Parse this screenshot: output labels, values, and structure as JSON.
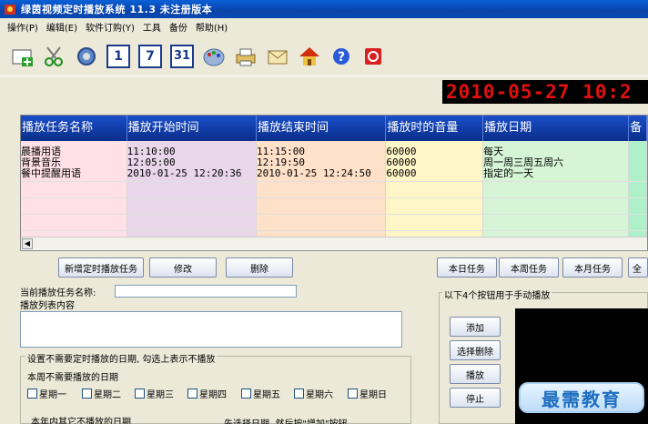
{
  "window": {
    "title": "绿茵视频定时播放系统 11.3  未注册版本"
  },
  "menu": [
    "操作(P)",
    "编辑(E)",
    "软件订购(Y)",
    "工具",
    "备份",
    "帮助(H)"
  ],
  "toolbar": {
    "icons": [
      "add-icon",
      "scissors-icon",
      "gear-icon",
      "calendar-1-icon",
      "calendar-7-icon",
      "calendar-31-icon",
      "palette-icon",
      "printer-icon",
      "mail-icon",
      "home-icon",
      "help-icon",
      "power-icon"
    ],
    "cal1": "1",
    "cal7": "7",
    "cal31": "31",
    "help": "?"
  },
  "clock": "2010-05-27 10:2",
  "grid": {
    "headers": [
      "播放任务名称",
      "播放开始时间",
      "播放结束时间",
      "播放时的音量",
      "播放日期",
      "备"
    ],
    "rows": [
      [
        "晨播用语",
        "11:10:00",
        "11:15:00",
        "60000",
        "每天"
      ],
      [
        "背景音乐",
        "12:05:00",
        "12:19:50",
        "60000",
        "周一周三周五周六"
      ],
      [
        "餐中提醒用语",
        "2010-01-25 12:20:36",
        "2010-01-25 12:24:50",
        "60000",
        "指定的一天"
      ]
    ]
  },
  "buttons": {
    "add_task": "新增定时播放任务",
    "modify": "修改",
    "delete": "删除",
    "today": "本日任务",
    "week": "本周任务",
    "month": "本月任务",
    "all": "全",
    "add": "添加",
    "select_delete": "选择删除",
    "play": "播放",
    "stop": "停止"
  },
  "form": {
    "current_task_label": "当前播放任务名称:",
    "current_task_value": "",
    "playlist_label": "播放列表内容",
    "skip_group_title": "设置不需要定时播放的日期, 勾选上表示不播放",
    "week_skip_label": "本周不需要播放的日期",
    "weekdays": [
      "星期一",
      "星期二",
      "星期三",
      "星期四",
      "星期五",
      "星期六",
      "星期日"
    ],
    "year_skip_label": "本年内其它不播放的日期",
    "year_hint": "先选择日期, 然后按\"增加\"按钮",
    "manual_label": "以下4个按钮用于手动播放"
  },
  "watermark": "最需教育"
}
